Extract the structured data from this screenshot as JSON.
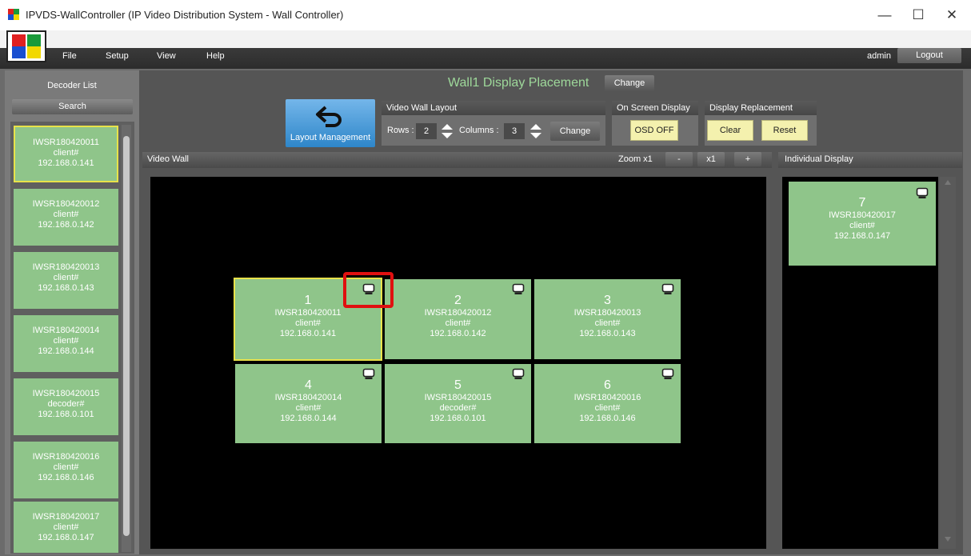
{
  "window": {
    "title": "IPVDS-WallController (IP Video Distribution System - Wall Controller)",
    "minimize": "—",
    "maximize": "☐",
    "close": "✕"
  },
  "menu": {
    "items": [
      "File",
      "Setup",
      "View",
      "Help"
    ],
    "user": "admin",
    "logout": "Logout"
  },
  "decoder_list": {
    "title": "Decoder List",
    "search": "Search",
    "items": [
      {
        "name": "IWSR180420011",
        "role": "client#",
        "ip": "192.168.0.141"
      },
      {
        "name": "IWSR180420012",
        "role": "client#",
        "ip": "192.168.0.142"
      },
      {
        "name": "IWSR180420013",
        "role": "client#",
        "ip": "192.168.0.143"
      },
      {
        "name": "IWSR180420014",
        "role": "client#",
        "ip": "192.168.0.144"
      },
      {
        "name": "IWSR180420015",
        "role": "decoder#",
        "ip": "192.168.0.101"
      },
      {
        "name": "IWSR180420016",
        "role": "client#",
        "ip": "192.168.0.146"
      },
      {
        "name": "IWSR180420017",
        "role": "client#",
        "ip": "192.168.0.147"
      }
    ]
  },
  "header": {
    "wall_title": "Wall1 Display Placement",
    "change": "Change",
    "layout_management": "Layout Management",
    "video_wall_layout": "Video Wall Layout",
    "rows_label": "Rows :",
    "rows_value": "2",
    "columns_label": "Columns :",
    "columns_value": "3",
    "layout_change": "Change",
    "osd_title": "On Screen Display",
    "osd_button": "OSD OFF",
    "replacement_title": "Display Replacement",
    "clear": "Clear",
    "reset": "Reset"
  },
  "video_wall": {
    "title": "Video Wall",
    "zoom_label": "Zoom x1",
    "zoom_minus": "-",
    "zoom_value": "x1",
    "zoom_plus": "+",
    "tiles": [
      {
        "num": "1",
        "name": "IWSR180420011",
        "role": "client#",
        "ip": "192.168.0.141"
      },
      {
        "num": "2",
        "name": "IWSR180420012",
        "role": "client#",
        "ip": "192.168.0.142"
      },
      {
        "num": "3",
        "name": "IWSR180420013",
        "role": "client#",
        "ip": "192.168.0.143"
      },
      {
        "num": "4",
        "name": "IWSR180420014",
        "role": "client#",
        "ip": "192.168.0.144"
      },
      {
        "num": "5",
        "name": "IWSR180420015",
        "role": "decoder#",
        "ip": "192.168.0.101"
      },
      {
        "num": "6",
        "name": "IWSR180420016",
        "role": "client#",
        "ip": "192.168.0.146"
      }
    ]
  },
  "individual_display": {
    "title": "Individual Display",
    "tile": {
      "num": "7",
      "name": "IWSR180420017",
      "role": "client#",
      "ip": "192.168.0.147"
    }
  },
  "colors": {
    "tile_green": "#8fc58a",
    "selected_border": "#e8e24a",
    "highlight_red": "#e01010",
    "title_green": "#9ed89a"
  }
}
